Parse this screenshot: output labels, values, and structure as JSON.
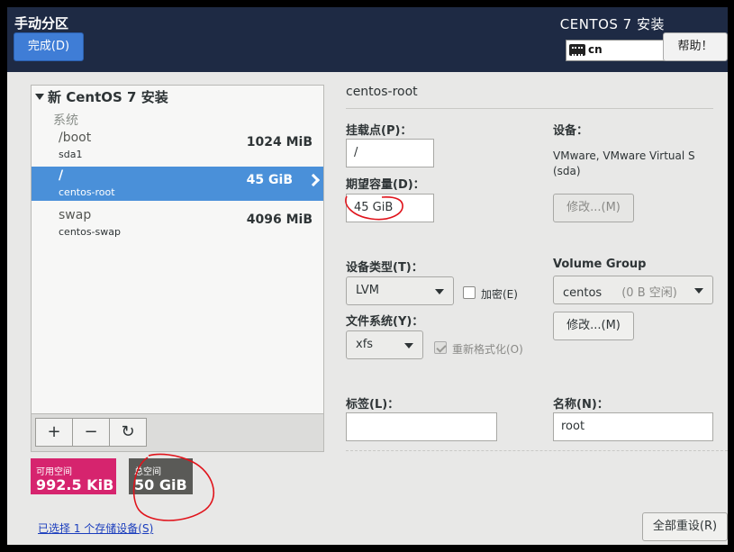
{
  "header": {
    "title": "手动分区",
    "done_label": "完成(D)",
    "product": "CENTOS 7 安装",
    "keyboard_layout": "cn",
    "help_label": "帮助！"
  },
  "tree": {
    "group": "新 CentOS 7 安装",
    "category": "系统",
    "partitions": [
      {
        "mount": "/boot",
        "device": "sda1",
        "size": "1024 MiB"
      },
      {
        "mount": "/",
        "device": "centos-root",
        "size": "45 GiB"
      },
      {
        "mount": "swap",
        "device": "centos-swap",
        "size": "4096 MiB"
      }
    ],
    "toolbar": {
      "add": "+",
      "remove": "−",
      "refresh": "↻"
    }
  },
  "space": {
    "available_label": "可用空间",
    "available_value": "992.5 KiB",
    "total_label": "总空间",
    "total_value": "50 GiB"
  },
  "storage_link": "已选择 1 个存储设备(S)",
  "details": {
    "title": "centos-root",
    "mount_label": "挂载点(P)：",
    "mount_value": "/",
    "capacity_label": "期望容量(D)：",
    "capacity_value": "45 GiB",
    "device_label": "设备：",
    "device_info_line1": "VMware, VMware Virtual S",
    "device_info_line2": "(sda)",
    "modify_label": "修改...(M)",
    "device_type_label": "设备类型(T)：",
    "device_type_value": "LVM",
    "encrypt_label": "加密(E)",
    "fs_label": "文件系统(Y)：",
    "fs_value": "xfs",
    "reformat_label": "重新格式化(O)",
    "vg_label": "Volume Group",
    "vg_value": "centos",
    "vg_free": "(0 B 空闲)",
    "vg_modify_label": "修改...(M)",
    "tag_label": "标签(L)：",
    "tag_value": "",
    "name_label": "名称(N)：",
    "name_value": "root"
  },
  "reset_label": "全部重设(R)",
  "colors": {
    "accent": "#4a90d9",
    "available": "#d6246e",
    "total": "#5a5a57",
    "annotation": "#e0141c"
  }
}
